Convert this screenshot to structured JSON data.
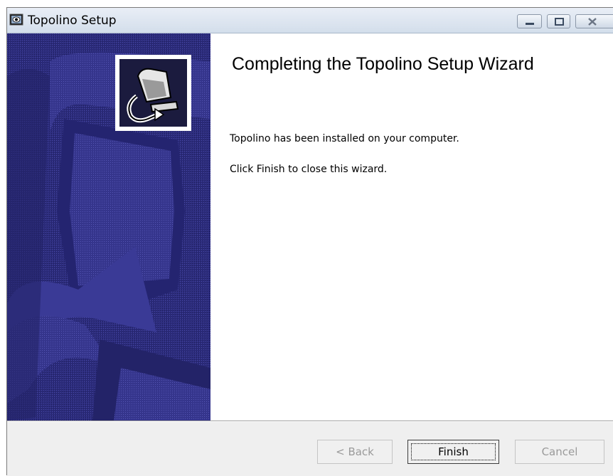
{
  "window": {
    "title": "Topolino Setup",
    "controls": {
      "minimize": "minimize",
      "maximize": "maximize",
      "close": "close"
    }
  },
  "main": {
    "heading": "Completing the Topolino Setup Wizard",
    "line1": "Topolino has been installed on your computer.",
    "line2": "Click Finish to close this wizard."
  },
  "buttons": {
    "back": "< Back",
    "finish": "Finish",
    "cancel": "Cancel"
  },
  "colors": {
    "sidebar_background": "#2d2d80",
    "sidebar_accent": "#3e3e9a",
    "footer_background": "#efefef"
  },
  "icons": {
    "app": "setup-eye-icon",
    "header_graphic": "installer-computer-icon"
  }
}
